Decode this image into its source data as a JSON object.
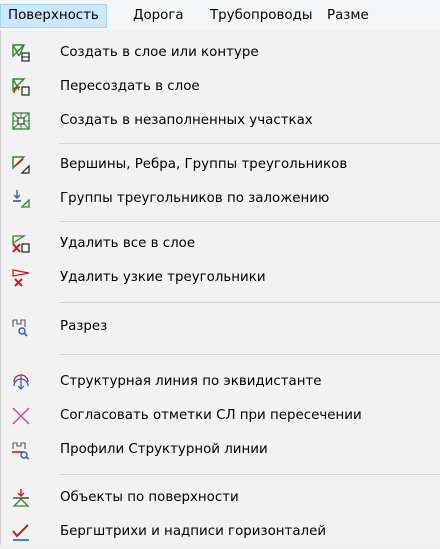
{
  "menubar": {
    "items": [
      "Поверхность",
      "Дорога",
      "Трубопроводы",
      "Разме"
    ]
  },
  "menu": {
    "items": [
      {
        "label": "Создать в слое или контуре",
        "icon": "tin-create-icon"
      },
      {
        "label": "Пересоздать в слое",
        "icon": "tin-recreate-icon"
      },
      {
        "label": "Создать в незаполненных участках",
        "icon": "tin-fill-gaps-icon"
      },
      {
        "label": "Вершины, Ребра, Группы треугольников",
        "icon": "tin-edit-icon"
      },
      {
        "label": "Группы треугольников по заложению",
        "icon": "slope-groups-icon"
      },
      {
        "label": "Удалить все в слое",
        "icon": "delete-in-layer-icon"
      },
      {
        "label": "Удалить узкие треугольники",
        "icon": "delete-narrow-triangles-icon"
      },
      {
        "label": "Разрез",
        "icon": "section-icon"
      },
      {
        "label": "Структурная линия по эквидистанте",
        "icon": "equidistant-line-icon"
      },
      {
        "label": "Согласовать отметки СЛ при пересечении",
        "icon": "reconcile-elevations-icon"
      },
      {
        "label": "Профили Структурной линии",
        "icon": "structure-line-profiles-icon"
      },
      {
        "label": "Объекты по поверхности",
        "icon": "objects-on-surface-icon"
      },
      {
        "label": "Бергштрихи и надписи горизонталей",
        "icon": "contour-labels-icon"
      }
    ]
  },
  "colors": {
    "active_menu_bg": "#cce8ff",
    "active_menu_border": "#99d1ff",
    "icon_red": "#d01818",
    "icon_green": "#2c8a2c",
    "icon_blue": "#2a5fbf"
  }
}
